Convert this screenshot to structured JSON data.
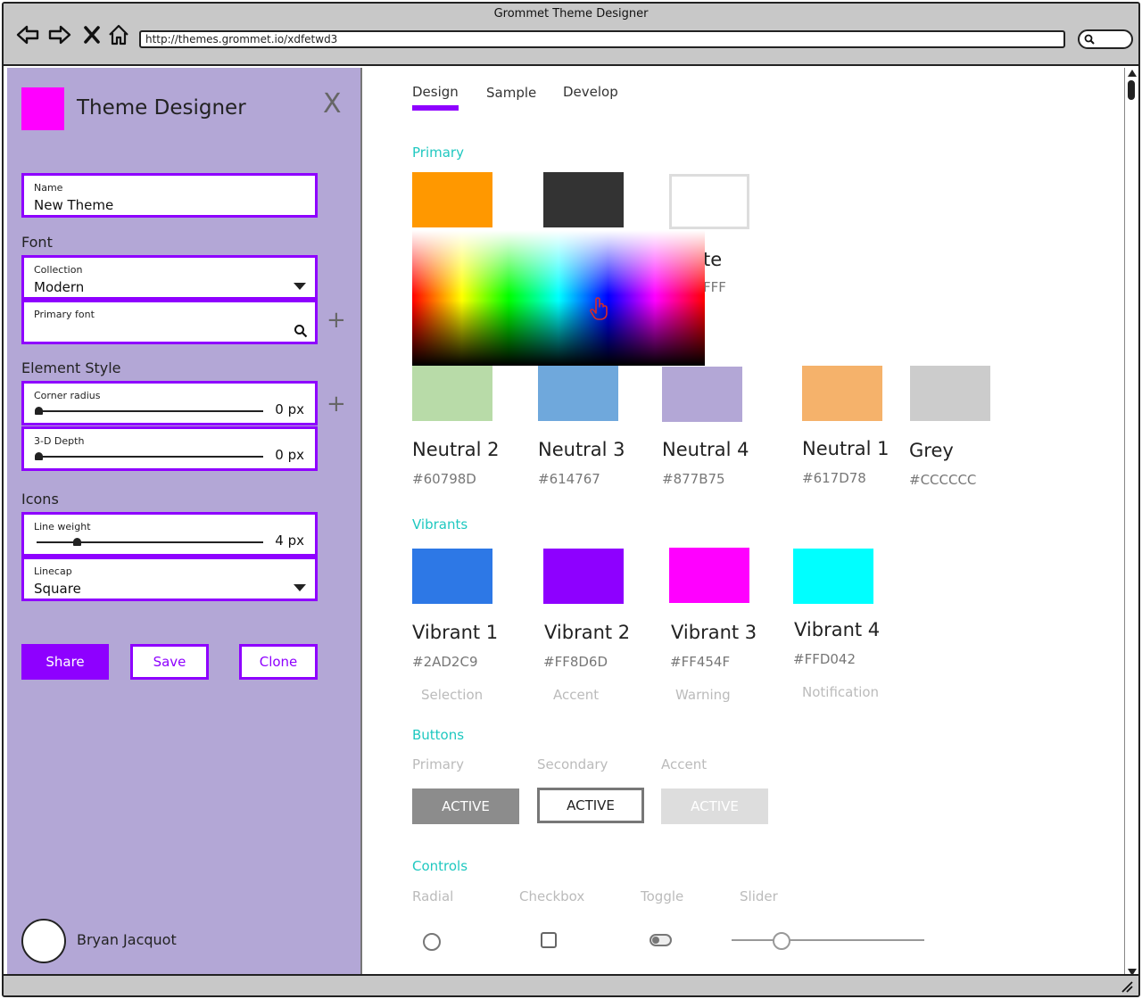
{
  "window": {
    "title": "Grommet Theme Designer",
    "url": "http://themes.grommet.io/xdfetwd3"
  },
  "sidebar": {
    "logo_color": "#FF00FF",
    "title": "Theme Designer",
    "close_label": "X",
    "name_field": {
      "label": "Name",
      "value": "New Theme"
    },
    "font_section": "Font",
    "collection_field": {
      "label": "Collection",
      "value": "Modern"
    },
    "primary_font_field": {
      "label": "Primary font",
      "value": ""
    },
    "element_style_section": "Element Style",
    "corner_radius": {
      "label": "Corner radius",
      "value": "0 px",
      "level": 0
    },
    "depth": {
      "label": "3-D Depth",
      "value": "0 px",
      "level": 0
    },
    "icons_section": "Icons",
    "line_weight": {
      "label": "Line weight",
      "value": "4 px",
      "level": 0.17
    },
    "linecap_field": {
      "label": "Linecap",
      "value": "Square"
    },
    "plus_label": "+",
    "share_label": "Share",
    "save_label": "Save",
    "clone_label": "Clone",
    "user_name": "Bryan Jacquot",
    "accent_color": "#8E00FF"
  },
  "main": {
    "tabs": [
      {
        "label": "Design",
        "active": true
      },
      {
        "label": "Sample",
        "active": false
      },
      {
        "label": "Develop",
        "active": false
      }
    ],
    "primary_title": "Primary",
    "primary_swatches": [
      {
        "color": "#FF9800"
      },
      {
        "color": "#333333"
      },
      {
        "color": "#FFFFFF",
        "name_fragment": "te",
        "hex_fragment": "FFF"
      }
    ],
    "neutrals": [
      {
        "name": "Neutral 2",
        "hex": "#60798D",
        "color": "#B8DBA8"
      },
      {
        "name": "Neutral 3",
        "hex": "#614767",
        "color": "#6FA8DC"
      },
      {
        "name": "Neutral 4",
        "hex": "#877B75",
        "color": "#B3A7D6"
      },
      {
        "name": "Neutral 1",
        "hex": "#617D78",
        "color": "#F5B26B"
      },
      {
        "name": "Grey",
        "hex": "#CCCCCC",
        "color": "#CCCCCC"
      }
    ],
    "vibrants_title": "Vibrants",
    "vibrants": [
      {
        "name": "Vibrant 1",
        "hex": "#2AD2C9",
        "role": "Selection",
        "color": "#2D78E6"
      },
      {
        "name": "Vibrant 2",
        "hex": "#FF8D6D",
        "role": "Accent",
        "color": "#8E00FF"
      },
      {
        "name": "Vibrant 3",
        "hex": "#FF454F",
        "role": "Warning",
        "color": "#FF00FF"
      },
      {
        "name": "Vibrant 4",
        "hex": "#FFD042",
        "role": "Notification",
        "color": "#00FFFF"
      }
    ],
    "buttons_title": "Buttons",
    "button_kinds": [
      "Primary",
      "Secondary",
      "Accent"
    ],
    "button_label": "ACTIVE",
    "controls_title": "Controls",
    "control_kinds": [
      "Radial",
      "Checkbox",
      "Toggle",
      "Slider"
    ],
    "slider_level": 0.26,
    "section_color": "#1FC8C0"
  }
}
